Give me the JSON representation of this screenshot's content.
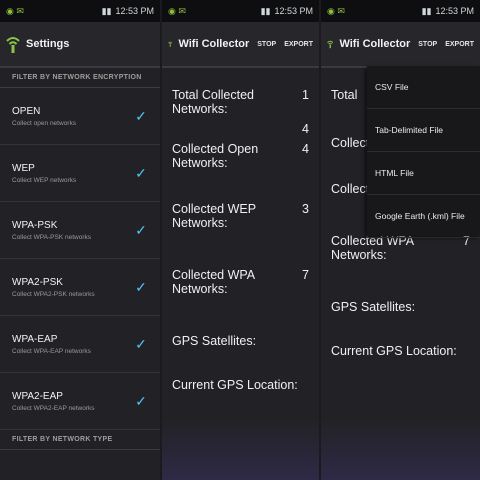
{
  "status": {
    "time": "12:53 PM"
  },
  "settings": {
    "title": "Settings",
    "section_encryption": "FILTER BY NETWORK ENCRYPTION",
    "prefs": [
      {
        "title": "OPEN",
        "summary": "Collect open networks"
      },
      {
        "title": "WEP",
        "summary": "Collect WEP networks"
      },
      {
        "title": "WPA-PSK",
        "summary": "Collect WPA-PSK networks"
      },
      {
        "title": "WPA2-PSK",
        "summary": "Collect WPA2-PSK networks"
      },
      {
        "title": "WPA-EAP",
        "summary": "Collect WPA-EAP networks"
      },
      {
        "title": "WPA2-EAP",
        "summary": "Collect WPA2-EAP networks"
      }
    ],
    "section_type": "FILTER BY NETWORK TYPE"
  },
  "collector": {
    "title": "Wifi Collector",
    "stop_label": "STOP",
    "export_label": "EXPORT",
    "total_label": "Total Collected Networks:",
    "total_value": "1",
    "total_value2": "4",
    "open_label": "Collected Open Networks:",
    "open_value": "4",
    "wep_label": "Collected WEP Networks:",
    "wep_value": "3",
    "wpa_label": "Collected WPA Networks:",
    "wpa_value": "7",
    "gps_sat_label": "GPS Satellites:",
    "gps_loc_label": "Current GPS Location:"
  },
  "collector_menu": {
    "title": "Wifi Collector",
    "stop_label": "STOP",
    "export_label": "EXPORT",
    "partial_total": "Total",
    "partial_collected": "Collected",
    "wpa_label": "Collected WPA Networks:",
    "wpa_value": "7",
    "gps_sat_label": "GPS Satellites:",
    "gps_loc_label": "Current GPS Location:",
    "menu_items": [
      "CSV File",
      "Tab-Delimited File",
      "HTML File",
      "Google Earth (.kml) File"
    ]
  }
}
